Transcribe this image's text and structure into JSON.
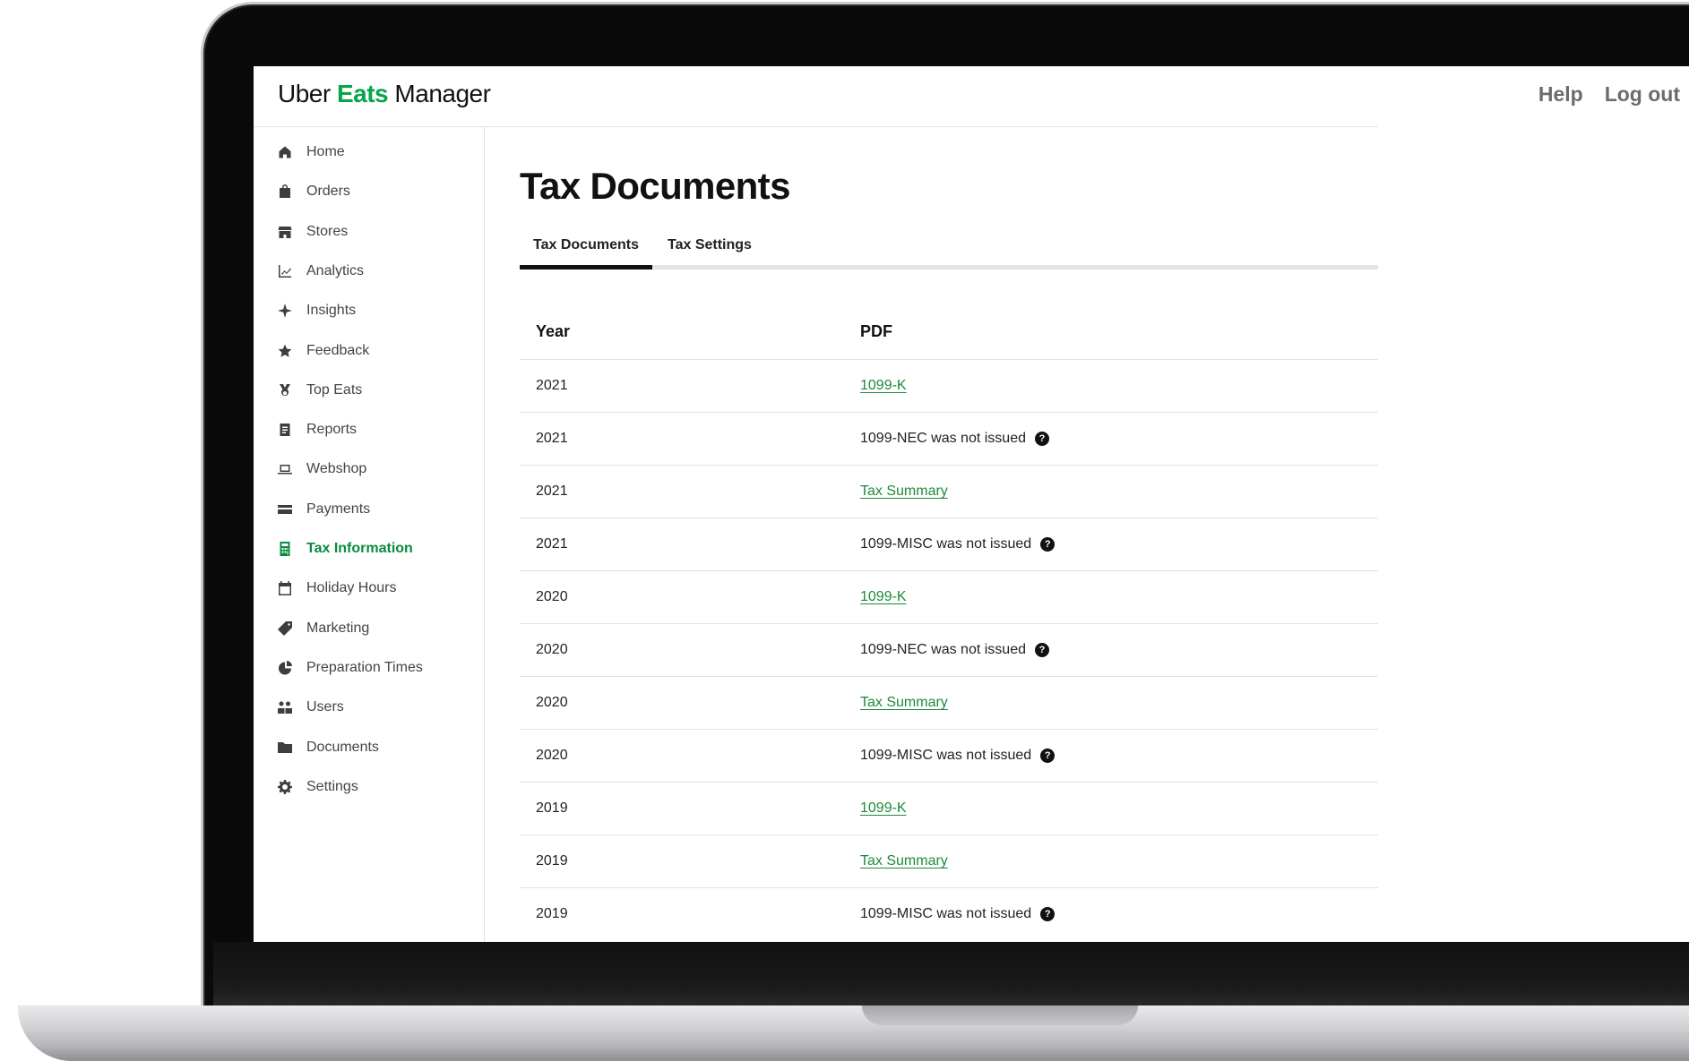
{
  "app": {
    "logo_uber": "Uber",
    "logo_eats": "Eats",
    "logo_manager": "Manager"
  },
  "header": {
    "help_label": "Help",
    "logout_label": "Log out"
  },
  "sidebar": {
    "items": [
      {
        "label": "Home",
        "icon": "home-icon"
      },
      {
        "label": "Orders",
        "icon": "bag-icon"
      },
      {
        "label": "Stores",
        "icon": "store-icon"
      },
      {
        "label": "Analytics",
        "icon": "chart-icon"
      },
      {
        "label": "Insights",
        "icon": "sparkle-icon"
      },
      {
        "label": "Feedback",
        "icon": "star-icon"
      },
      {
        "label": "Top Eats",
        "icon": "medal-icon"
      },
      {
        "label": "Reports",
        "icon": "report-icon"
      },
      {
        "label": "Webshop",
        "icon": "laptop-icon"
      },
      {
        "label": "Payments",
        "icon": "card-icon"
      },
      {
        "label": "Tax Information",
        "icon": "calculator-icon",
        "active": true
      },
      {
        "label": "Holiday Hours",
        "icon": "calendar-icon"
      },
      {
        "label": "Marketing",
        "icon": "tag-icon"
      },
      {
        "label": "Preparation Times",
        "icon": "timer-icon"
      },
      {
        "label": "Users",
        "icon": "users-icon"
      },
      {
        "label": "Documents",
        "icon": "folder-icon"
      },
      {
        "label": "Settings",
        "icon": "gear-icon"
      }
    ]
  },
  "main": {
    "title": "Tax Documents",
    "tabs": [
      {
        "label": "Tax Documents",
        "active": true
      },
      {
        "label": "Tax Settings",
        "active": false
      }
    ],
    "table": {
      "columns": [
        "Year",
        "PDF"
      ],
      "rows": [
        {
          "year": "2021",
          "pdf": "1099-K",
          "type": "link"
        },
        {
          "year": "2021",
          "pdf": "1099-NEC was not issued",
          "type": "not_issued"
        },
        {
          "year": "2021",
          "pdf": "Tax Summary",
          "type": "link"
        },
        {
          "year": "2021",
          "pdf": "1099-MISC was not issued",
          "type": "not_issued"
        },
        {
          "year": "2020",
          "pdf": "1099-K",
          "type": "link"
        },
        {
          "year": "2020",
          "pdf": "1099-NEC was not issued",
          "type": "not_issued"
        },
        {
          "year": "2020",
          "pdf": "Tax Summary",
          "type": "link"
        },
        {
          "year": "2020",
          "pdf": "1099-MISC was not issued",
          "type": "not_issued"
        },
        {
          "year": "2019",
          "pdf": "1099-K",
          "type": "link"
        },
        {
          "year": "2019",
          "pdf": "Tax Summary",
          "type": "link"
        },
        {
          "year": "2019",
          "pdf": "1099-MISC was not issued",
          "type": "not_issued"
        }
      ]
    }
  },
  "colors": {
    "brand_green": "#06a64a",
    "link_green": "#1f8a3a",
    "active_nav": "#0a8a3f"
  }
}
